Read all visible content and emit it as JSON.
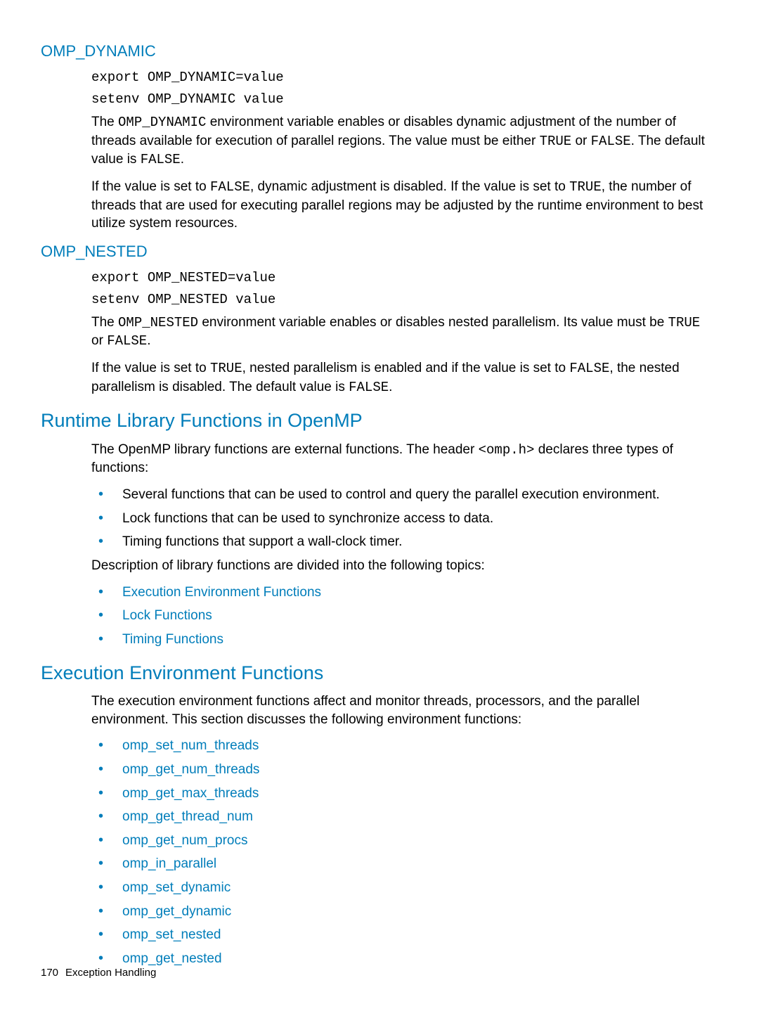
{
  "sections": {
    "omp_dynamic": {
      "heading": "OMP_DYNAMIC",
      "code1": "export OMP_DYNAMIC=value",
      "code2": "setenv OMP_DYNAMIC value",
      "p1_a": "The ",
      "p1_code1": "OMP_DYNAMIC",
      "p1_b": " environment variable enables or disables dynamic adjustment of the number of threads available for execution of parallel regions. The value must be either ",
      "p1_code2": "TRUE",
      "p1_c": " or ",
      "p1_code3": "FALSE",
      "p1_d": ". The default value is ",
      "p1_code4": "FALSE",
      "p1_e": ".",
      "p2_a": "If the value is set to ",
      "p2_code1": "FALSE",
      "p2_b": ", dynamic adjustment is disabled. If the value is set to ",
      "p2_code2": "TRUE",
      "p2_c": ", the number of threads that are used for executing parallel regions may be adjusted by the runtime environment to best utilize system resources."
    },
    "omp_nested": {
      "heading": "OMP_NESTED",
      "code1": "export OMP_NESTED=value",
      "code2": "setenv OMP_NESTED value",
      "p1_a": "The ",
      "p1_code1": "OMP_NESTED",
      "p1_b": " environment variable enables or disables nested parallelism. Its value must be ",
      "p1_code2": "TRUE",
      "p1_c": " or ",
      "p1_code3": "FALSE",
      "p1_d": ".",
      "p2_a": "If the value is set to ",
      "p2_code1": "TRUE",
      "p2_b": ", nested parallelism is enabled and if the value is set to ",
      "p2_code2": "FALSE",
      "p2_c": ", the nested parallelism is disabled. The default value is ",
      "p2_code3": "FALSE",
      "p2_d": "."
    },
    "runtime": {
      "heading": "Runtime Library Functions in OpenMP",
      "p1_a": "The OpenMP library functions are external functions. The header ",
      "p1_code1": "<omp.h>",
      "p1_b": " declares three types of functions:",
      "bullets1": [
        "Several functions that can be used to control and query the parallel execution environment.",
        "Lock functions that can be used to synchronize access to data.",
        "Timing functions that support a wall-clock timer."
      ],
      "p2": "Description of library functions are divided into the following topics:",
      "bullets2": [
        "Execution Environment Functions",
        "Lock Functions",
        "Timing Functions"
      ]
    },
    "exec_env": {
      "heading": "Execution Environment Functions",
      "p1": "The execution environment functions affect and monitor threads, processors, and the parallel environment. This section discusses the following environment functions:",
      "links": [
        "omp_set_num_threads",
        "omp_get_num_threads",
        "omp_get_max_threads",
        "omp_get_thread_num",
        "omp_get_num_procs",
        "omp_in_parallel",
        "omp_set_dynamic",
        "omp_get_dynamic",
        "omp_set_nested",
        "omp_get_nested"
      ]
    }
  },
  "footer": {
    "page_no": "170",
    "title": "Exception Handling"
  }
}
